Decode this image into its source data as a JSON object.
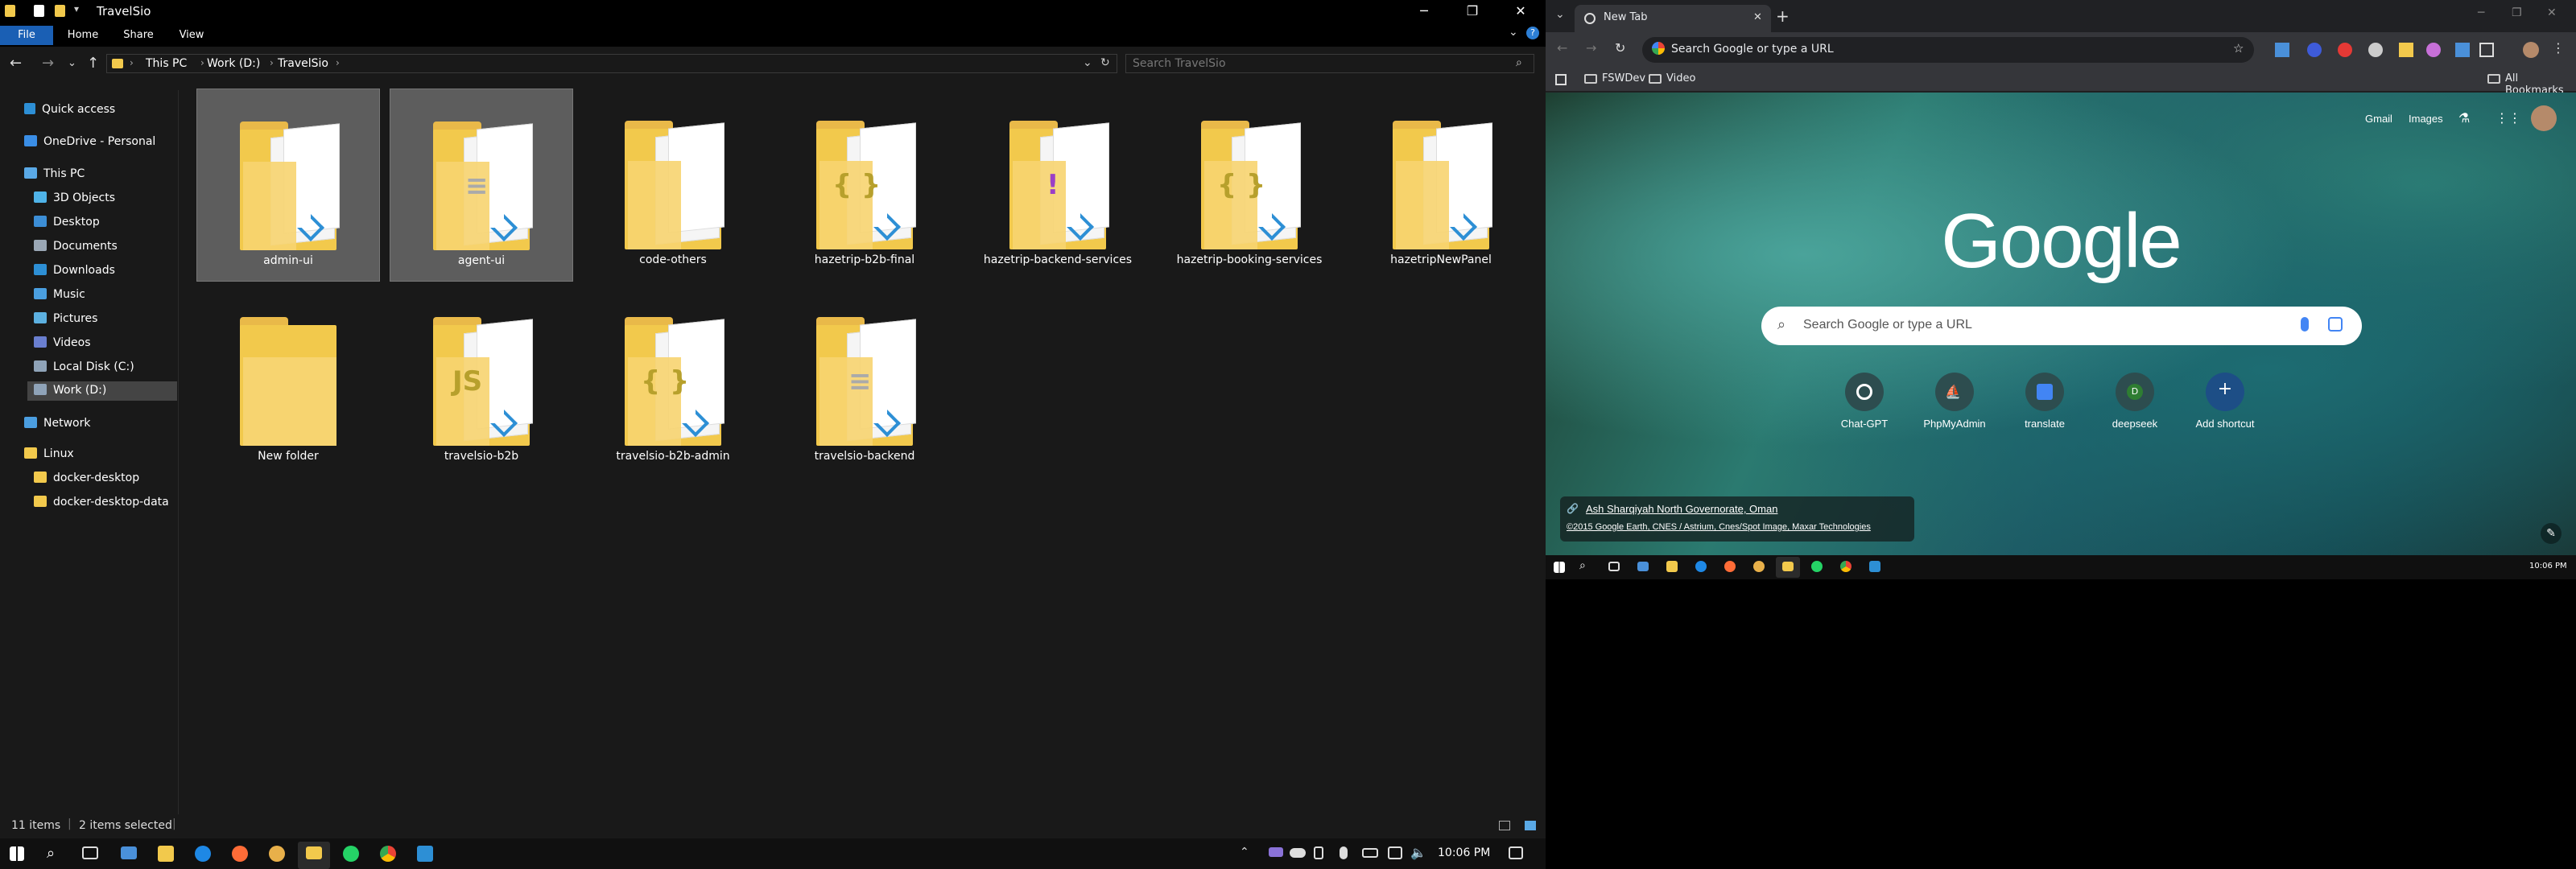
{
  "explorer": {
    "title": "TravelSio",
    "ribbon_tabs": [
      "File",
      "Home",
      "Share",
      "View"
    ],
    "breadcrumb": [
      "This PC",
      "Work (D:)",
      "TravelSio"
    ],
    "search_placeholder": "Search TravelSio",
    "nav": {
      "quick_access": "Quick access",
      "onedrive": "OneDrive - Personal",
      "this_pc": "This PC",
      "objects3d": "3D Objects",
      "desktop": "Desktop",
      "documents": "Documents",
      "downloads": "Downloads",
      "music": "Music",
      "pictures": "Pictures",
      "videos": "Videos",
      "local_disk": "Local Disk (C:)",
      "work_disk": "Work (D:)",
      "network": "Network",
      "linux": "Linux",
      "docker_desktop": "docker-desktop",
      "docker_desktop_data": "docker-desktop-data"
    },
    "folders": [
      {
        "name": "admin-ui",
        "selected": true
      },
      {
        "name": "agent-ui",
        "selected": true
      },
      {
        "name": "code-others",
        "selected": false
      },
      {
        "name": "hazetrip-b2b-final",
        "selected": false
      },
      {
        "name": "hazetrip-backend-services",
        "selected": false
      },
      {
        "name": "hazetrip-booking-services",
        "selected": false
      },
      {
        "name": "hazetripNewPanel",
        "selected": false
      },
      {
        "name": "New folder",
        "selected": false
      },
      {
        "name": "travelsio-b2b",
        "selected": false
      },
      {
        "name": "travelsio-b2b-admin",
        "selected": false
      },
      {
        "name": "travelsio-backend",
        "selected": false
      }
    ],
    "status": {
      "items": "11 items",
      "selected": "2 items selected"
    }
  },
  "taskbar_left": {
    "time": "10:06 PM"
  },
  "chrome": {
    "tab_title": "New Tab",
    "omnibox_placeholder": "Search Google or type a URL",
    "bookmarks": [
      "FSWDev",
      "Video"
    ],
    "all_bookmarks": "All Bookmarks",
    "top_links": [
      "Gmail",
      "Images"
    ],
    "logo_text": "Google",
    "search_placeholder": "Search Google or type a URL",
    "shortcuts": [
      "Chat-GPT",
      "PhpMyAdmin",
      "translate",
      "deepseek",
      "Add shortcut"
    ],
    "shortcut_letter_deepseek": "D",
    "attribution": {
      "location": "Ash Sharqiyah North Governorate, Oman",
      "credit": "©2015 Google Earth, CNES / Astrium, Cnes/Spot Image, Maxar Technologies"
    },
    "taskbar_time": "10:06 PM"
  },
  "colors": {
    "accent_blue": "#1a5fb4",
    "folder_yellow": "#f2c94c",
    "vscode_blue": "#2d8fd5"
  }
}
